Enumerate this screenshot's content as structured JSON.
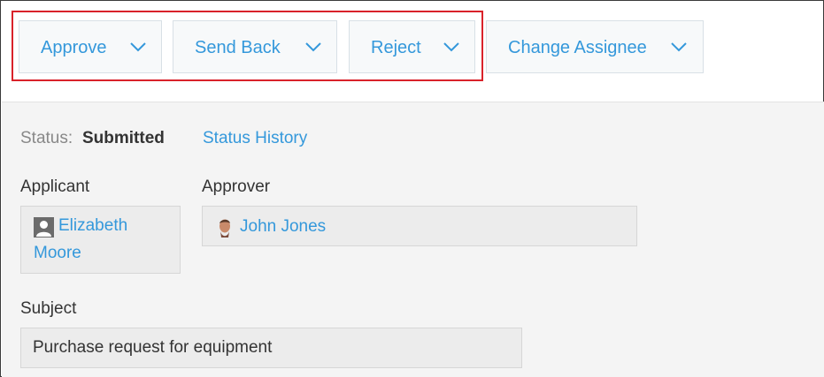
{
  "toolbar": {
    "actions": [
      {
        "label": "Approve"
      },
      {
        "label": "Send Back"
      },
      {
        "label": "Reject"
      },
      {
        "label": "Change Assignee"
      }
    ]
  },
  "status": {
    "label": "Status:",
    "value": "Submitted",
    "history_link": "Status History"
  },
  "applicant": {
    "label": "Applicant",
    "name_line1": "Elizabeth",
    "name_line2": "Moore"
  },
  "approver": {
    "label": "Approver",
    "name": "John Jones"
  },
  "subject": {
    "label": "Subject",
    "value": "Purchase request for equipment"
  },
  "colors": {
    "link": "#3498db",
    "highlight": "#d9222a",
    "panel_bg": "#f4f4f4"
  }
}
